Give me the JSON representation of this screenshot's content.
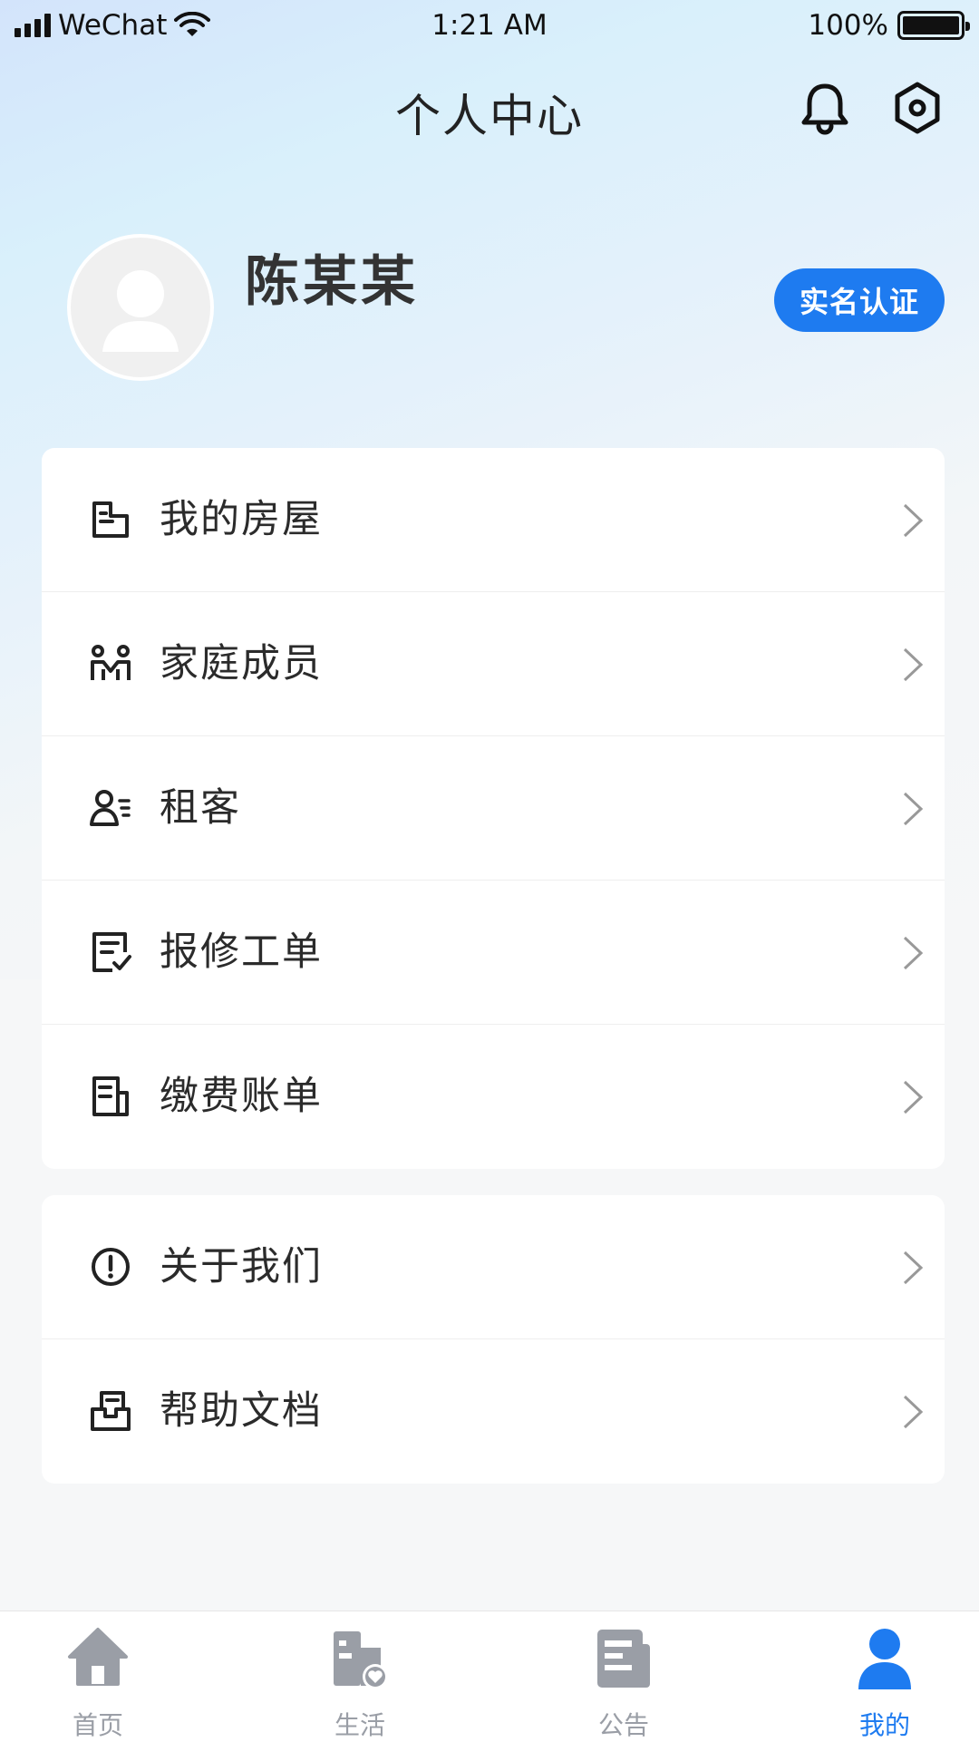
{
  "status_bar": {
    "carrier": "WeChat",
    "time": "1:21 AM",
    "battery": "100%"
  },
  "header": {
    "title": "个人中心",
    "icons": [
      "bell-icon",
      "settings-hexagon-icon"
    ]
  },
  "profile": {
    "name": "陈某某",
    "verify_button": "实名认证"
  },
  "menu_group_1": [
    {
      "label": "我的房屋",
      "icon": "house-icon"
    },
    {
      "label": "家庭成员",
      "icon": "family-icon"
    },
    {
      "label": "租客",
      "icon": "tenant-icon"
    },
    {
      "label": "报修工单",
      "icon": "repair-order-icon"
    },
    {
      "label": "缴费账单",
      "icon": "bill-icon"
    }
  ],
  "menu_group_2": [
    {
      "label": "关于我们",
      "icon": "info-icon"
    },
    {
      "label": "帮助文档",
      "icon": "help-doc-icon"
    }
  ],
  "tabs": [
    {
      "label": "首页",
      "icon": "home-icon",
      "active": false
    },
    {
      "label": "生活",
      "icon": "life-icon",
      "active": false
    },
    {
      "label": "公告",
      "icon": "notice-icon",
      "active": false
    },
    {
      "label": "我的",
      "icon": "user-icon",
      "active": true
    }
  ],
  "colors": {
    "accent": "#1e7bf0",
    "inactive_tab": "#9a9ea6",
    "text": "#2b2b2b"
  }
}
